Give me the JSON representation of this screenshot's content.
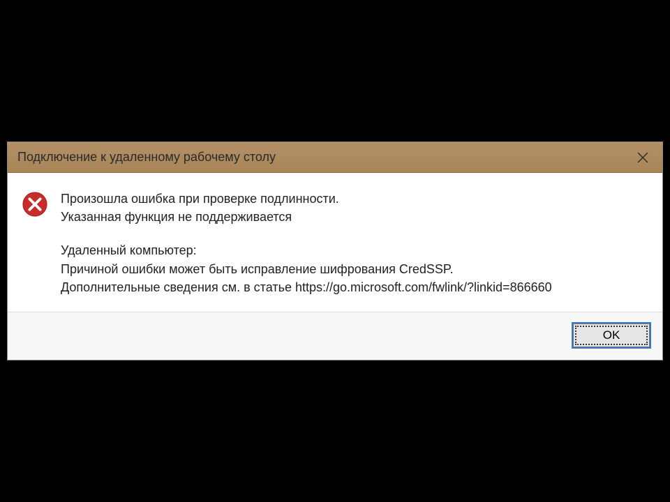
{
  "titlebar": {
    "title": "Подключение к удаленному рабочему столу"
  },
  "message": {
    "line1": "Произошла ошибка при проверке подлинности.",
    "line2": "Указанная функция не поддерживается",
    "line3": "Удаленный компьютер:",
    "line4": "Причиной ошибки может быть исправление шифрования CredSSP.",
    "line5": "Дополнительные сведения см. в статье https://go.microsoft.com/fwlink/?linkid=866660"
  },
  "buttons": {
    "ok": "OK"
  }
}
